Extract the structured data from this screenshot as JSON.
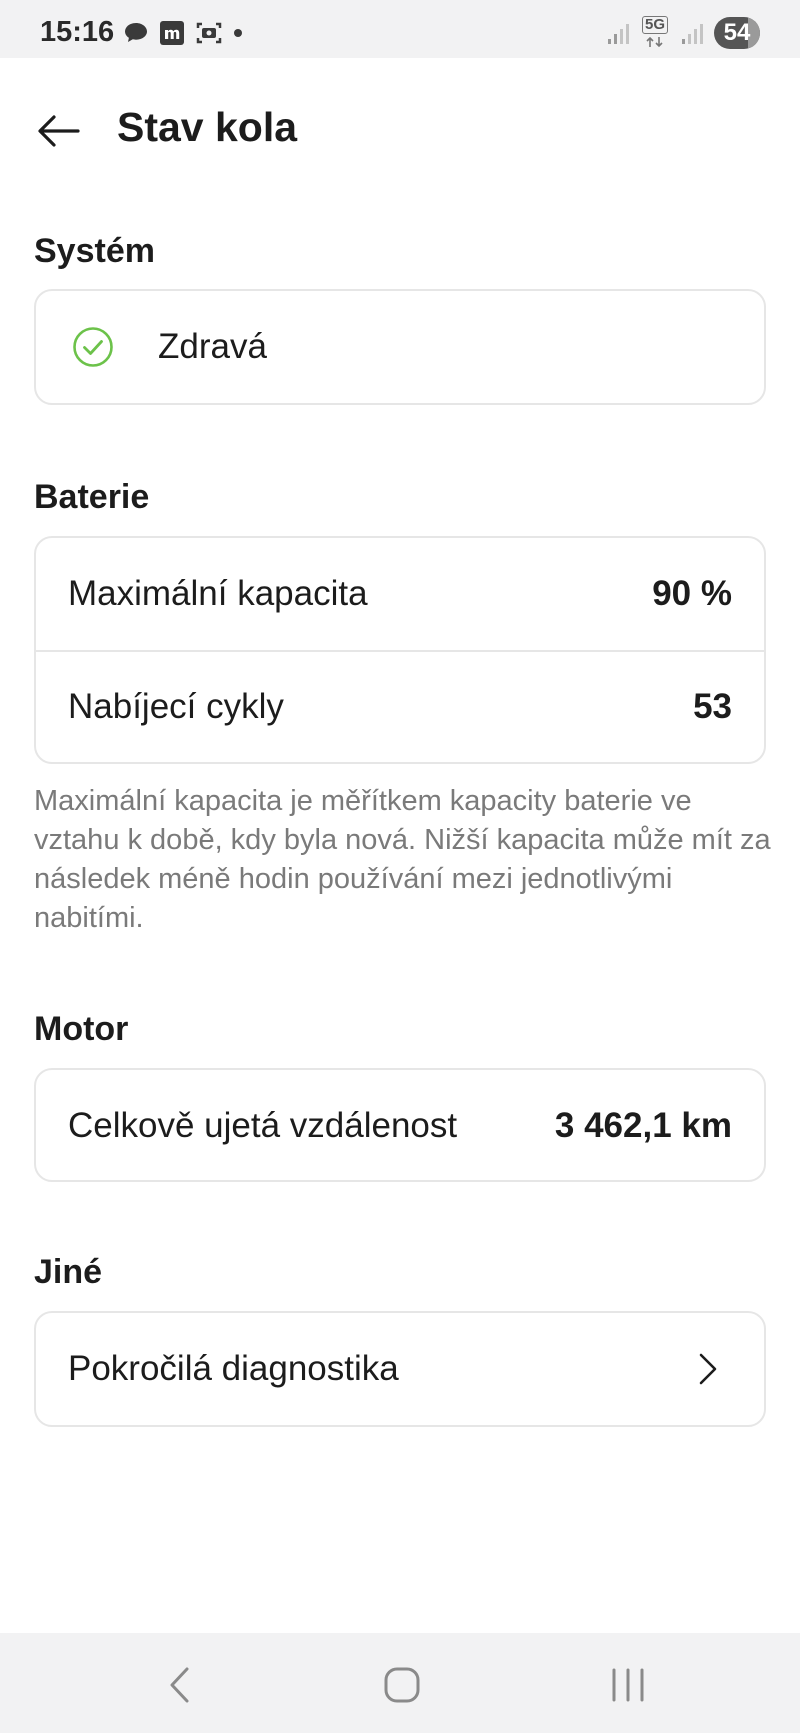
{
  "status_bar": {
    "time": "15:16",
    "network": "5G",
    "battery": "54",
    "icons": [
      "chat-icon",
      "m-app-icon",
      "screenshot-icon",
      "dot-icon",
      "signal-icon",
      "signal-icon",
      "battery-icon"
    ]
  },
  "header": {
    "title": "Stav kola",
    "back_icon": "arrow-left-icon"
  },
  "system": {
    "section_title": "Systém",
    "status_label": "Zdravá",
    "status_icon": "check-circle-icon",
    "status_color": "#6cc24a"
  },
  "battery": {
    "section_title": "Baterie",
    "rows": [
      {
        "label": "Maximální kapacita",
        "value": "90 %"
      },
      {
        "label": "Nabíjecí cykly",
        "value": "53"
      }
    ],
    "note": "Maximální kapacita je měřítkem kapacity baterie ve vztahu k době, kdy byla nová. Nižší kapacita může mít za následek méně hodin používání mezi jednotlivými nabitími."
  },
  "motor": {
    "section_title": "Motor",
    "rows": [
      {
        "label": "Celkově ujetá vzdálenost",
        "value": "3 462,1 km"
      }
    ]
  },
  "other": {
    "section_title": "Jiné",
    "rows": [
      {
        "label": "Pokročilá diagnostika",
        "icon": "chevron-right-icon"
      }
    ]
  },
  "nav_bar": {
    "buttons": [
      "back-nav-icon",
      "home-nav-icon",
      "recents-nav-icon"
    ]
  }
}
